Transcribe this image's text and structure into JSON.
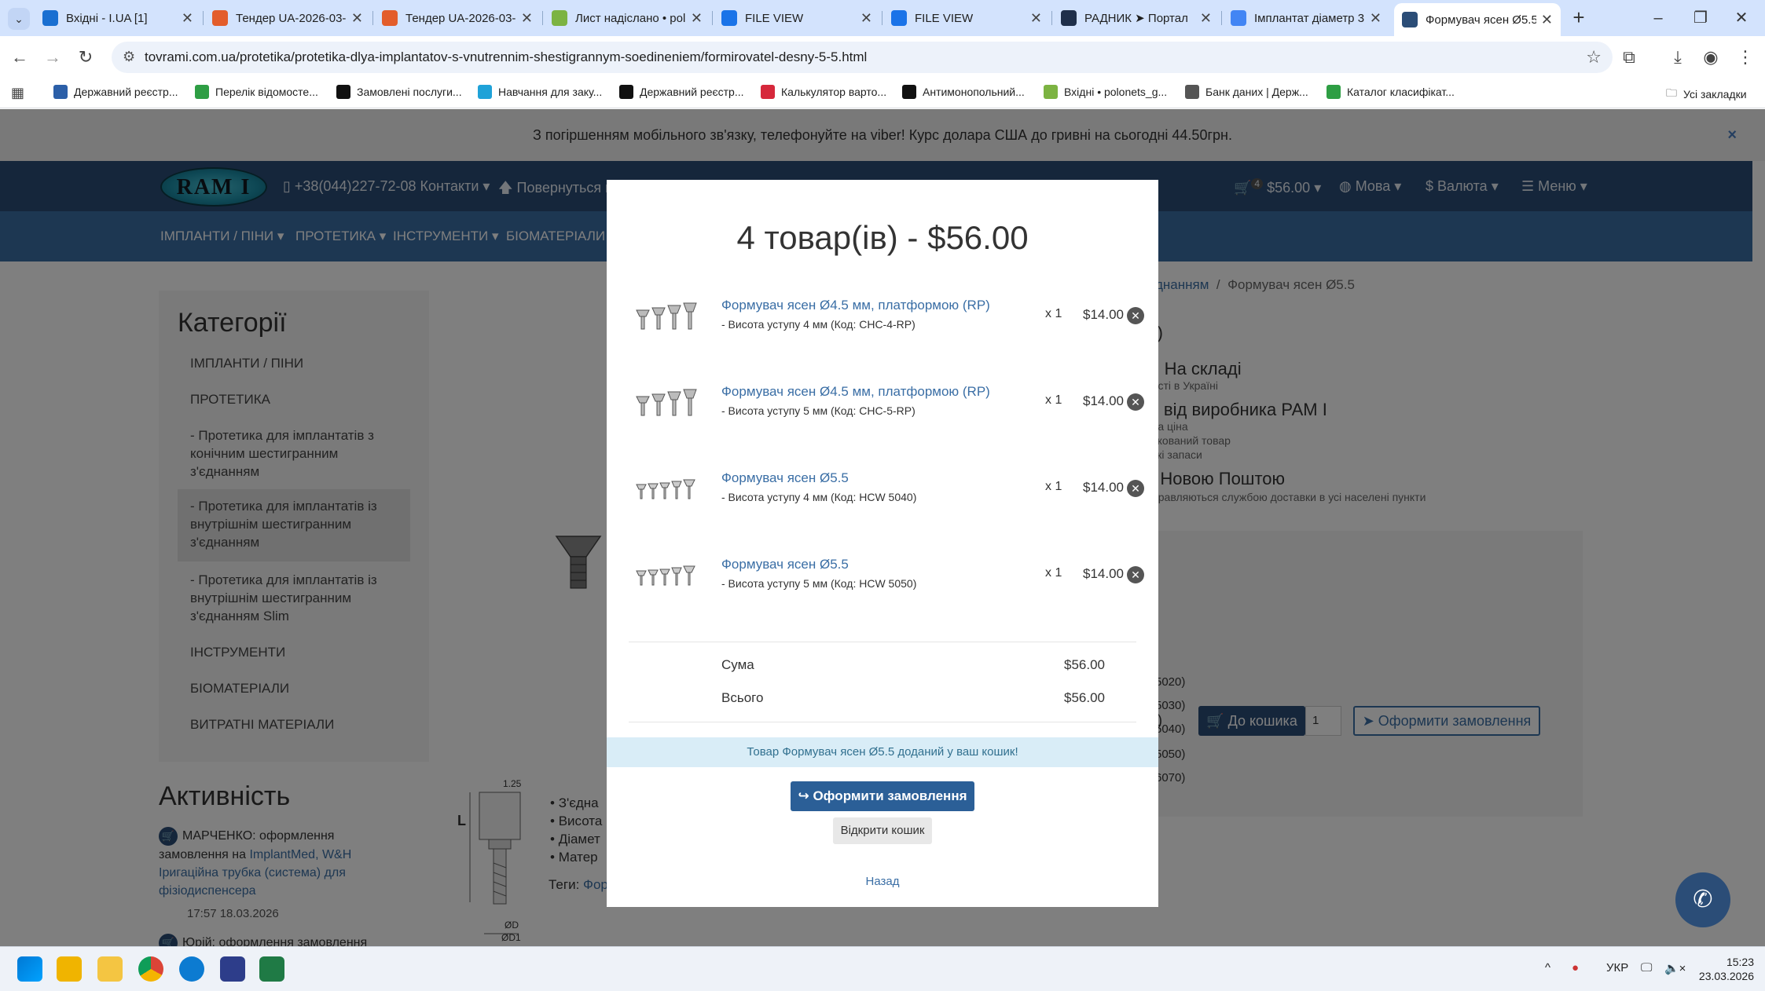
{
  "browser": {
    "tabs": [
      {
        "title": "Вхідні - I.UA [1]",
        "favicon_color": "#1a6fd1",
        "active": false
      },
      {
        "title": "Тендер UA-2026-03-",
        "favicon_color": "#e35d2b",
        "active": false
      },
      {
        "title": "Тендер UA-2026-03-",
        "favicon_color": "#e35d2b",
        "active": false
      },
      {
        "title": "Лист надіслано • pol",
        "favicon_color": "#7cb342",
        "active": false
      },
      {
        "title": "FILE VIEW",
        "favicon_color": "#1a73e8",
        "active": false
      },
      {
        "title": "FILE VIEW",
        "favicon_color": "#1a73e8",
        "active": false
      },
      {
        "title": "РАДНИК ➤ Портал",
        "favicon_color": "#1f2f4a",
        "active": false
      },
      {
        "title": "Імплантат діаметр 3.",
        "favicon_color": "#4285f4",
        "active": false
      },
      {
        "title": "Формувач ясен Ø5.5",
        "favicon_color": "#2b4d77",
        "active": true
      }
    ],
    "new_tab": "+",
    "minimize": "–",
    "restore": "❐",
    "close": "✕",
    "url": "tovrami.com.ua/protetika/protetika-dlya-implantatov-s-vnutrennim-shestigrannym-soedineniem/formirovatel-desny-5-5.html",
    "bookmarks": [
      {
        "label": "Державний реєстр...",
        "color": "#2c5fa8"
      },
      {
        "label": "Перелік відомосте...",
        "color": "#2e9e44"
      },
      {
        "label": "Замовлені послуги...",
        "color": "#111111"
      },
      {
        "label": "Навчання для заку...",
        "color": "#1fa2d8"
      },
      {
        "label": "Державний реєстр...",
        "color": "#111111"
      },
      {
        "label": "Калькулятор варто...",
        "color": "#d6283b"
      },
      {
        "label": "Антимонопольний...",
        "color": "#111111"
      },
      {
        "label": "Вхідні • polonets_g...",
        "color": "#7cb342"
      },
      {
        "label": "Банк даних | Держ...",
        "color": "#555555"
      },
      {
        "label": "Каталог класифікат...",
        "color": "#2e9e44"
      }
    ],
    "all_bookmarks": "Усі закладки"
  },
  "site": {
    "notice": "З погіршенням мобільного зв'язку, телефонуйте на viber! Курс долара США до гривні на сьогодні 44.50грн.",
    "notice_close": "×",
    "logo": "RAM I",
    "phone": "+38(044)227-72-08 Контакти",
    "back": "Повернуться н",
    "cart_count": "4",
    "cart_total": "$56.00",
    "lang": "Мова",
    "currency": "Валюта",
    "menu": "Меню",
    "menubar": [
      "ІМПЛАНТИ / ПІНИ",
      "ПРОТЕТИКА",
      "ІНСТРУМЕНТИ",
      "БІОМАТЕРІАЛИ"
    ],
    "breadcrumb_link": "днанням",
    "breadcrumb_sep": "/",
    "breadcrumb_current": "Формувач ясен Ø5.5",
    "sidebar_title": "Категорії",
    "sidebar": [
      {
        "label": "ІМПЛАНТИ / ПІНИ",
        "sub": false
      },
      {
        "label": "ПРОТЕТИКА",
        "sub": false
      },
      {
        "label": "- Протетика для імплантатів з конічним шестигранним з'єднанням",
        "sub": true
      },
      {
        "label": "- Протетика для імплантатів із внутрішнім шестигранним з'єднанням",
        "sub": true,
        "active": true
      },
      {
        "label": "- Протетика для імплантатів із внутрішнім шестигранним з'єднанням Slim",
        "sub": true
      },
      {
        "label": "ІНСТРУМЕНТИ",
        "sub": false
      },
      {
        "label": "БІОМАТЕРІАЛИ",
        "sub": false
      },
      {
        "label": "ВИТРАТНІ МАТЕРІАЛИ",
        "sub": false
      }
    ],
    "activity_title": "Активність",
    "activity": [
      {
        "who": "МАРЧЕНКО: оформлення замовлення на ",
        "link": "ImplantMed, W&H Іригаційна трубка (система) для фізіодиспенсера",
        "time": "17:57 18.03.2026"
      },
      {
        "who": "Юрій: оформлення замовлення",
        "link": "",
        "time": ""
      }
    ],
    "product_lines": [
      {
        "text": "V)",
        "size": "big"
      },
      {
        "text": "ь: На складі",
        "size": "big"
      },
      {
        "text": "ності в Україні",
        "size": "small"
      },
      {
        "text": "ія від виробника РАМ І",
        "size": "big"
      },
      {
        "text": "пна ціна",
        "size": "small"
      },
      {
        "text": "фікований товар",
        "size": "small"
      },
      {
        "text": "ські запаси",
        "size": "small"
      },
      {
        "text": "а Новою Поштою",
        "size": "big"
      },
      {
        "text": "дправляються службою доставки в усі населені пункти",
        "size": "small"
      }
    ],
    "variants": [
      "5020)",
      "5030)",
      "5040)",
      "5050)",
      "6070)"
    ],
    "qty_paren": "н.)",
    "add_to_cart": "До кошика",
    "qty_value": "1",
    "order_button": "Оформити замовлення",
    "specs": [
      "З'єдна",
      "Висота",
      "Діамет",
      "Матер"
    ],
    "tags_label": "Теги: ",
    "tags_link": "Фор",
    "diagram_labels": {
      "top": "1.25",
      "left": "L",
      "d": "ØD",
      "d1": "ØD1"
    }
  },
  "modal": {
    "title": "4 товар(ів) - $56.00",
    "items": [
      {
        "name": "Формувач ясен Ø4.5 мм, платформою (RP)",
        "option": "- Висота уступу 4 мм (Код: CHC-4-RP)",
        "qty": "x 1",
        "price": "$14.00"
      },
      {
        "name": "Формувач ясен Ø4.5 мм, платформою (RP)",
        "option": "- Висота уступу 5 мм (Код: CHC-5-RP)",
        "qty": "x 1",
        "price": "$14.00"
      },
      {
        "name": "Формувач ясен Ø5.5",
        "option": "- Висота уступу 4 мм (Код: HCW 5040)",
        "qty": "x 1",
        "price": "$14.00"
      },
      {
        "name": "Формувач ясен Ø5.5",
        "option": "- Висота уступу 5 мм (Код: HCW 5050)",
        "qty": "x 1",
        "price": "$14.00"
      }
    ],
    "subtotal_label": "Сума",
    "subtotal": "$56.00",
    "total_label": "Всього",
    "total": "$56.00",
    "alert": "Товар Формувач ясен Ø5.5 доданий у ваш кошик!",
    "checkout": "Оформити замовлення",
    "view_cart": "Відкрити кошик",
    "back": "Назад"
  },
  "taskbar": {
    "lang": "УКР",
    "time": "15:23",
    "date": "23.03.2026",
    "sound": "🔈×"
  },
  "colors": {
    "nav_dark": "#2b4d77",
    "nav_blue": "#3a6ea5",
    "link": "#3a6ea5",
    "alert_bg": "#d9edf7"
  }
}
